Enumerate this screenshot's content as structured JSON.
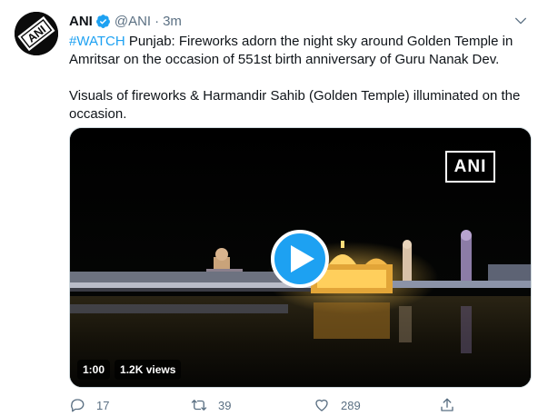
{
  "tweet": {
    "author": {
      "name": "ANI",
      "handle": "@ANI",
      "separator": "·",
      "time": "3m",
      "avatar_text": "ANI",
      "verified_icon": "verified-badge-icon"
    },
    "body": {
      "hashtag": "#WATCH",
      "line1": " Punjab: Fireworks adorn the night sky around Golden Temple in Amritsar on the occasion of 551st birth anniversary of Guru Nanak Dev.",
      "line2": "Visuals of fireworks & Harmandir Sahib (Golden Temple) illuminated on the occasion."
    },
    "media": {
      "watermark": "ANI",
      "duration": "1:00",
      "views": "1.2K views",
      "play_icon": "play-icon"
    },
    "actions": {
      "reply_count": "17",
      "retweet_count": "39",
      "like_count": "289"
    }
  },
  "colors": {
    "accent": "#1da1f2",
    "secondary_text": "#5b7083",
    "primary_text": "#0f1419"
  }
}
